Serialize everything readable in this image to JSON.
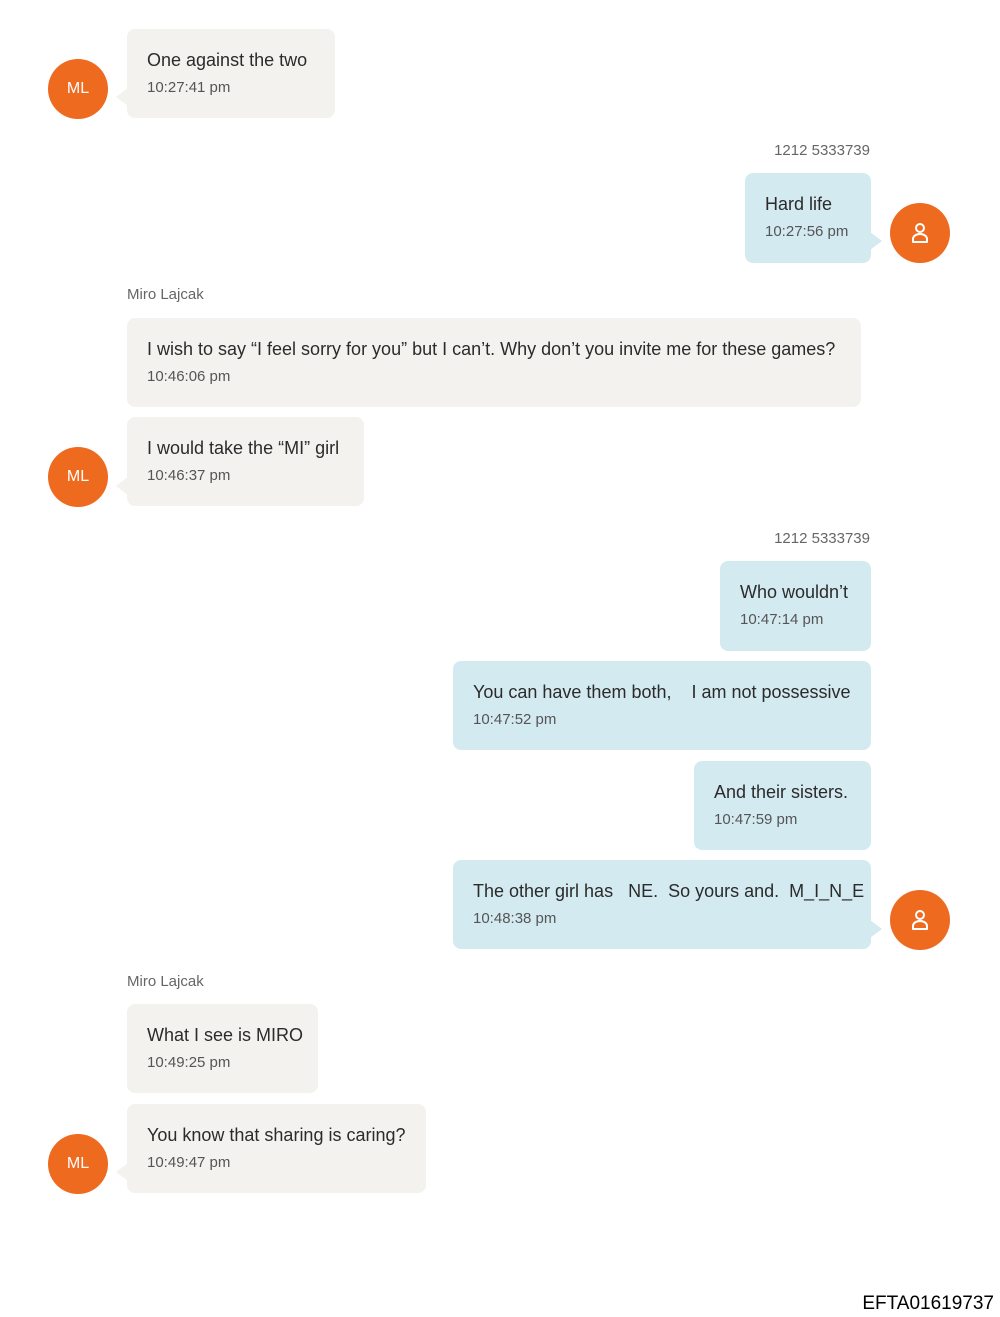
{
  "messages": [
    {
      "text": "One against the two",
      "time": "10:27:41 pm"
    },
    {
      "text": "Hard life",
      "time": "10:27:56 pm"
    },
    {
      "text": "I wish to say “I feel sorry for you” but I can’t. Why don’t you invite me for these games?",
      "time": "10:46:06 pm"
    },
    {
      "text": "I would take the “MI” girl",
      "time": "10:46:37 pm"
    },
    {
      "text": "Who wouldn’t",
      "time": "10:47:14 pm"
    },
    {
      "text": "You can have them both,    I am not possessive",
      "time": "10:47:52 pm"
    },
    {
      "text": "And their sisters.",
      "time": "10:47:59 pm"
    },
    {
      "text": "The other girl has   NE.  So yours and.  M_I_N_E",
      "time": "10:48:38 pm"
    },
    {
      "text": "What I see is MIRO",
      "time": "10:49:25 pm"
    },
    {
      "text": "You know that sharing is caring?",
      "time": "10:49:47 pm"
    }
  ],
  "senders": {
    "incoming_name": "Miro Lajcak",
    "outgoing_number": "1212 5333739",
    "incoming_initials": "ML",
    "outgoing_icon": "person-icon"
  },
  "colors": {
    "incoming_bubble": "#f3f2ef",
    "outgoing_bubble": "#d4eaf1",
    "avatar": "#ee6a1f"
  },
  "footer": {
    "doc_id": "EFTA01619737"
  }
}
